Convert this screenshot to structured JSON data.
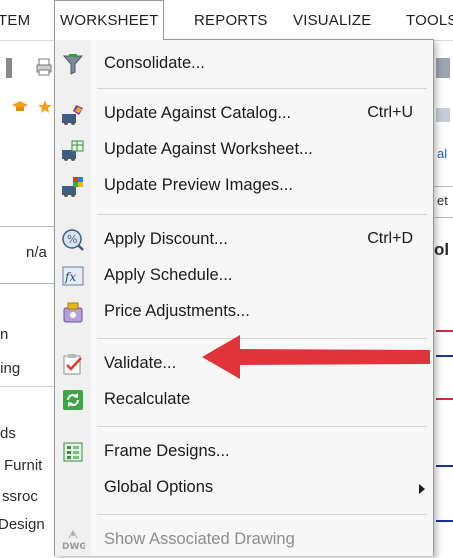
{
  "menubar": {
    "tabs": [
      {
        "label": "TEM"
      },
      {
        "label": "WORKSHEET"
      },
      {
        "label": "REPORTS"
      },
      {
        "label": "VISUALIZE"
      },
      {
        "label": "TOOLS"
      }
    ]
  },
  "background": {
    "field_value": "n/a",
    "right_texts": [
      "al",
      "et",
      "ol"
    ],
    "left_texts": [
      "n",
      "ting",
      "ds",
      "Furnit",
      "ssroc",
      "Design"
    ]
  },
  "dropdown": {
    "items": [
      {
        "label": "Consolidate...",
        "shortcut": "",
        "icon": "consolidate-icon"
      },
      {
        "label": "Update Against Catalog...",
        "shortcut": "Ctrl+U",
        "icon": "update-catalog-icon"
      },
      {
        "label": "Update Against Worksheet...",
        "shortcut": "",
        "icon": "update-worksheet-icon"
      },
      {
        "label": "Update Preview Images...",
        "shortcut": "",
        "icon": "update-images-icon"
      },
      {
        "label": "Apply Discount...",
        "shortcut": "Ctrl+D",
        "icon": "discount-icon"
      },
      {
        "label": "Apply Schedule...",
        "shortcut": "",
        "icon": "schedule-icon"
      },
      {
        "label": "Price Adjustments...",
        "shortcut": "",
        "icon": "price-adjust-icon"
      },
      {
        "label": "Validate...",
        "shortcut": "",
        "icon": "validate-icon"
      },
      {
        "label": "Recalculate",
        "shortcut": "",
        "icon": "recalculate-icon"
      },
      {
        "label": "Frame Designs...",
        "shortcut": "",
        "icon": "frame-designs-icon"
      },
      {
        "label": "Global Options",
        "shortcut": "",
        "icon": ""
      },
      {
        "label": "Show Associated Drawing",
        "shortcut": "",
        "icon": "dwg-icon",
        "icon_text": "DWG"
      }
    ]
  },
  "colors": {
    "accent_red": "#e0343a",
    "menu_bg": "#f7f7f7",
    "separator": "#d5d5d5",
    "disabled_text": "#8d8d8d"
  }
}
